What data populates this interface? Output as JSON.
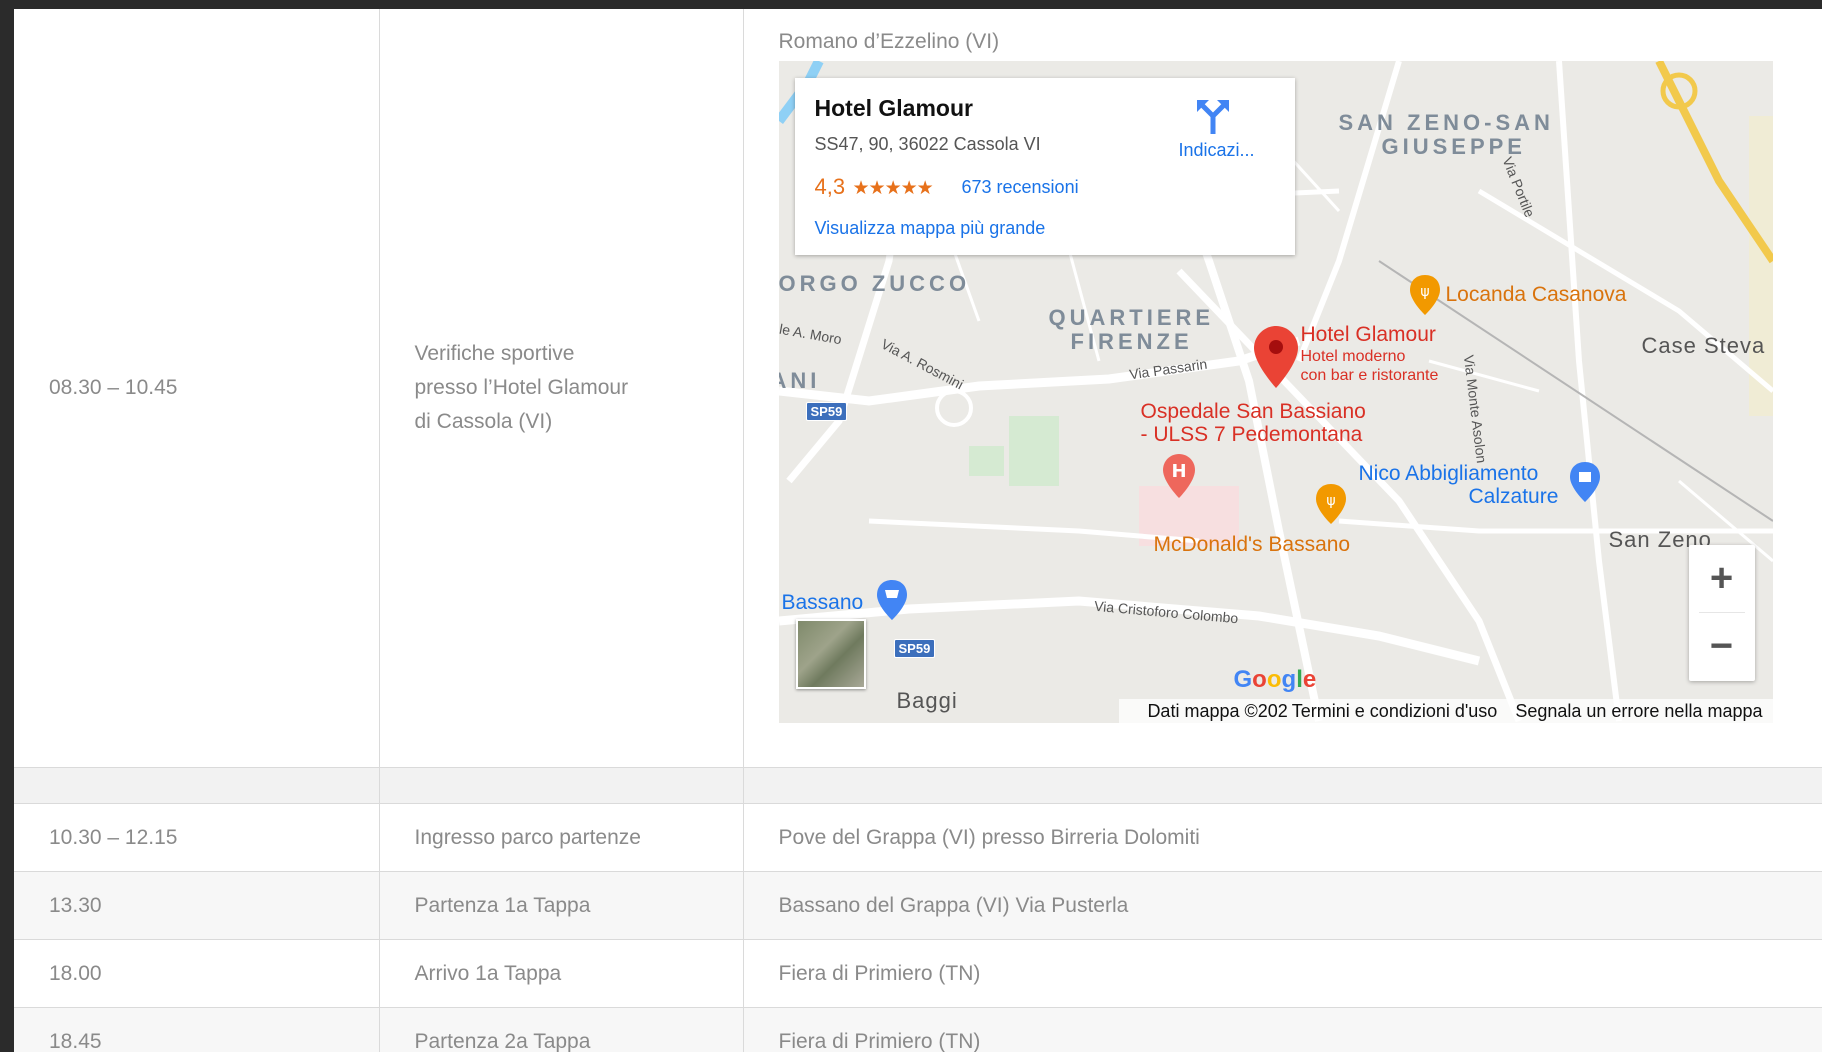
{
  "schedule": {
    "first": {
      "time": "08.30 – 10.45",
      "activity_lines": [
        "Verifiche sportive",
        "presso l’Hotel Glamour",
        "di Cassola (VI)"
      ],
      "location": "Romano d’Ezzelino (VI)"
    },
    "rows": [
      {
        "time": "10.30 – 12.15",
        "activity": "Ingresso parco partenze",
        "location": "Pove del Grappa (VI) presso Birreria Dolomiti"
      },
      {
        "time": "13.30",
        "activity": "Partenza 1a Tappa",
        "location": "Bassano del Grappa (VI) Via Pusterla"
      },
      {
        "time": "18.00",
        "activity": "Arrivo 1a Tappa",
        "location": "Fiera di Primiero (TN)"
      },
      {
        "time": "18.45",
        "activity": "Partenza 2a Tappa",
        "location": "Fiera di Primiero (TN)"
      }
    ]
  },
  "map": {
    "card": {
      "title": "Hotel Glamour",
      "address": "SS47, 90, 36022 Cassola VI",
      "rating": "4,3",
      "stars": "★★★★★",
      "reviews": "673 recensioni",
      "larger_map": "Visualizza mappa più grande",
      "directions": "Indicazi..."
    },
    "areas": {
      "san_zeno_1": "SAN ZENO-SAN",
      "san_zeno_2": "GIUSEPPE",
      "borgo_zucco": "ORGO ZUCCO",
      "quartiere_1": "QUARTIERE",
      "quartiere_2": "FIRENZE",
      "ani": "ANI"
    },
    "roads": {
      "moro": "le A. Moro",
      "rosmini": "Via A. Rosmini",
      "passarin": "Via Passarin",
      "portile": "Via Portile",
      "asolan": "Via Monte Asolon",
      "colombo": "Via Cristoforo Colombo",
      "sp59": "SP59"
    },
    "pois": {
      "locanda": "Locanda Casanova",
      "hotel": "Hotel Glamour",
      "hotel_sub1": "Hotel moderno",
      "hotel_sub2": "con bar e ristorante",
      "ospedale1": "Ospedale San Bassiano",
      "ospedale2": "- ULSS 7 Pedemontana",
      "nico1": "Nico Abbigliamento",
      "nico2": "Calzature",
      "mcd": "McDonald's Bassano",
      "bassano": "Bassano"
    },
    "places": {
      "case": "Case Steva",
      "san_zeno": "San Zeno",
      "baggi": "Baggi"
    },
    "zoom_in": "+",
    "zoom_out": "−",
    "footer": {
      "data": "Dati mappa ©202",
      "terms": "Termini e condizioni d'uso",
      "report": "Segnala un errore nella mappa"
    },
    "google": "Google",
    "colors": {
      "pin": "#ea4335",
      "orange": "#f29900",
      "blue": "#4285f4"
    }
  }
}
